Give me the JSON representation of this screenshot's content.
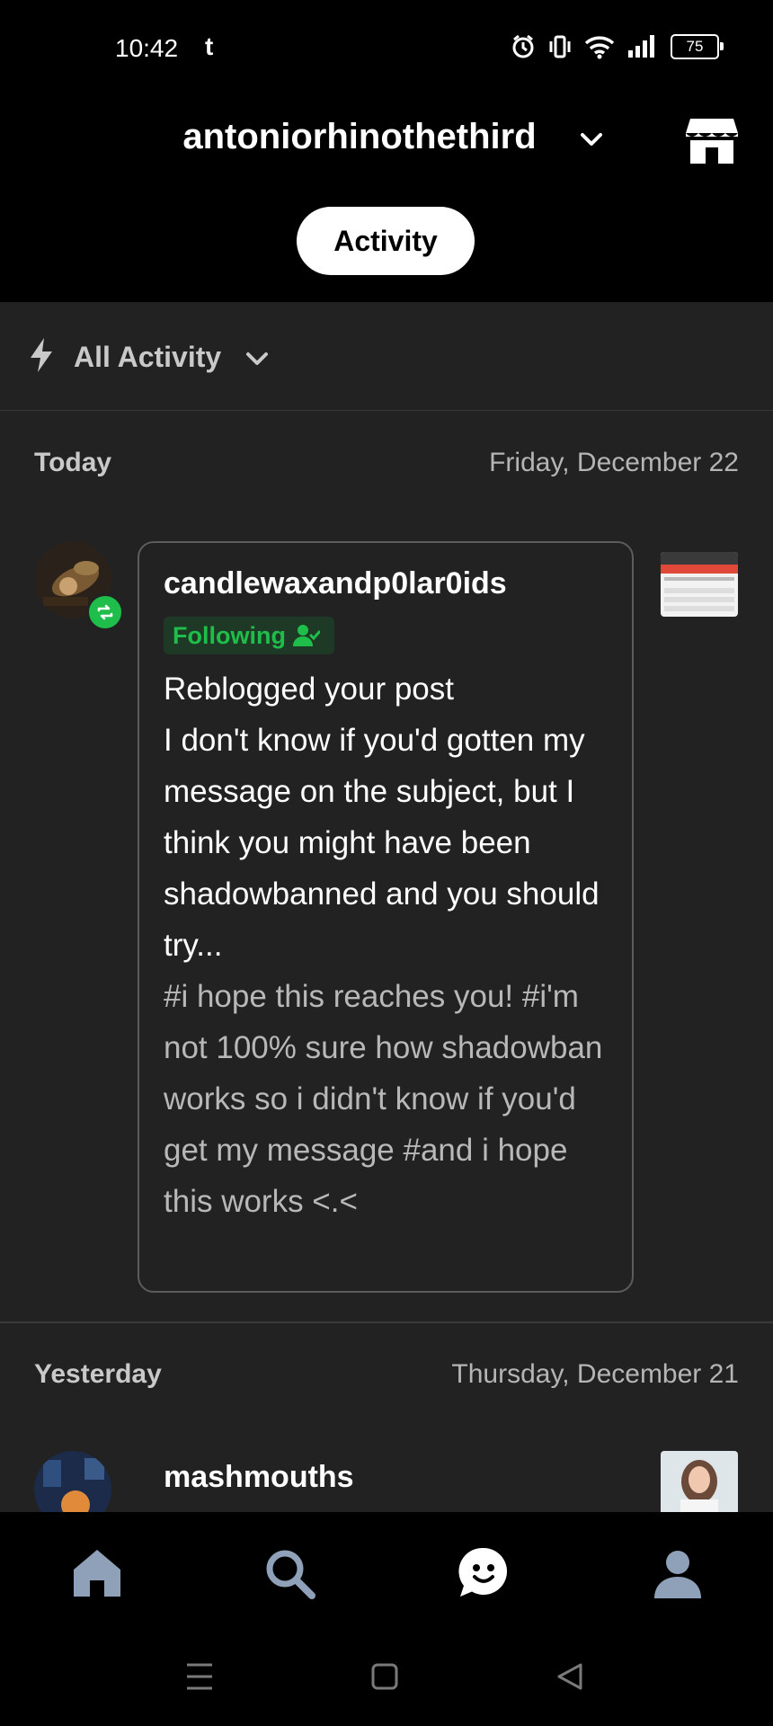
{
  "status": {
    "time": "10:42",
    "app_glyph": "t",
    "battery": "75"
  },
  "header": {
    "username": "antoniorhinothethird",
    "active_tab": "Activity",
    "shop_icon": "storefront-icon"
  },
  "filter": {
    "label": "All Activity"
  },
  "sections": [
    {
      "label": "Today",
      "date": "Friday, December 22"
    },
    {
      "label": "Yesterday",
      "date": "Thursday, December 21"
    }
  ],
  "notification": {
    "blog_name": "candlewaxandp0lar0ids",
    "following_label": "Following",
    "body": "Reblogged your post\nI don't know if you'd gotten my message on the subject, but I think you might have been shadowbanned and you should try...",
    "tags": "#i hope this reaches you! #i'm not 100% sure how shadowban works so i didn't know if you'd get my message #and i hope this works <.<"
  },
  "notification2": {
    "blog_name": "mashmouths"
  },
  "nav": {
    "items": [
      "home-icon",
      "search-icon",
      "activity-icon",
      "account-icon"
    ]
  },
  "colors": {
    "accent_green": "#1fbe4a",
    "background": "#222222"
  }
}
